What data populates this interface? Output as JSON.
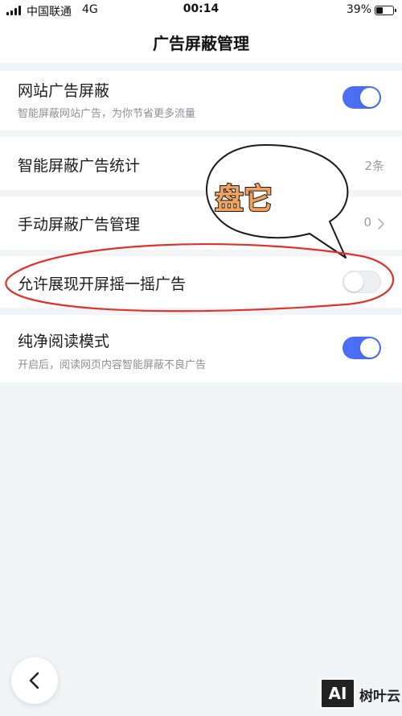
{
  "status_bar": {
    "carrier": "中国联通",
    "network": "4G",
    "time": "00:14",
    "battery": "39%"
  },
  "header": {
    "title": "广告屏蔽管理"
  },
  "settings": [
    {
      "title": "网站广告屏蔽",
      "subtitle": "智能屏蔽网站广告，为你节省更多流量",
      "toggle_on": true
    },
    {
      "title": "智能屏蔽广告统计",
      "value": "2条"
    },
    {
      "title": "手动屏蔽广告管理",
      "value": "0"
    },
    {
      "title": "允许展现开屏摇一摇广告",
      "toggle_on": false
    },
    {
      "title": "纯净阅读模式",
      "subtitle": "开启后，阅读网页内容智能屏蔽不良广告",
      "toggle_on": true
    }
  ],
  "annotation": {
    "bubble_text": "盘它"
  },
  "watermark": {
    "logo": "AI",
    "text": "树叶云"
  },
  "colors": {
    "accent": "#4b6ef5",
    "annotation_red": "#e0312b",
    "bubble_text": "#f5a15a"
  }
}
